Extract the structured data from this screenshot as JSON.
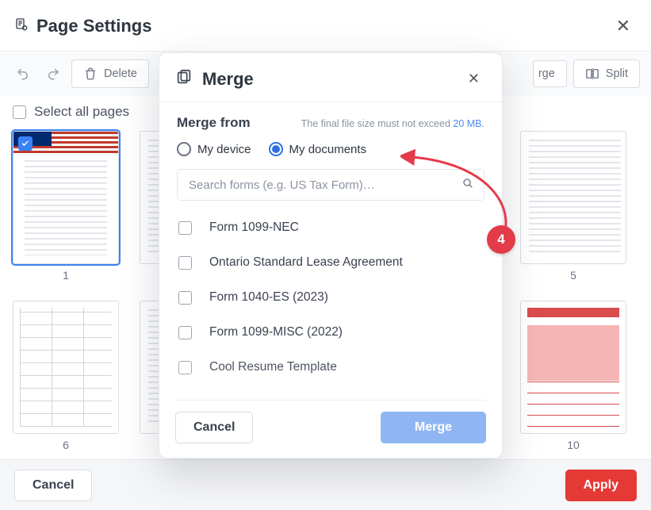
{
  "header": {
    "title": "Page Settings"
  },
  "toolbar": {
    "delete_label": "Delete",
    "merge_visible_label": "rge",
    "split_label": "Split"
  },
  "select_all_label": "Select all pages",
  "thumbs_row1": [
    "1",
    "",
    "",
    "",
    "5"
  ],
  "thumbs_row2": [
    "6",
    "",
    "",
    "",
    "10"
  ],
  "footer": {
    "cancel": "Cancel",
    "apply": "Apply"
  },
  "modal": {
    "title": "Merge",
    "from_label": "Merge from",
    "hint_prefix": "The final file size must not exceed ",
    "hint_limit": "20 MB.",
    "radio_device": "My device",
    "radio_docs": "My documents",
    "search_placeholder": "Search forms (e.g. US Tax Form)…",
    "docs": [
      "Form 1099-NEC",
      "Ontario Standard Lease Agreement",
      "Form 1040-ES (2023)",
      "Form 1099-MISC (2022)",
      "Cool Resume Template"
    ],
    "cancel": "Cancel",
    "merge": "Merge"
  },
  "step_badge": "4"
}
